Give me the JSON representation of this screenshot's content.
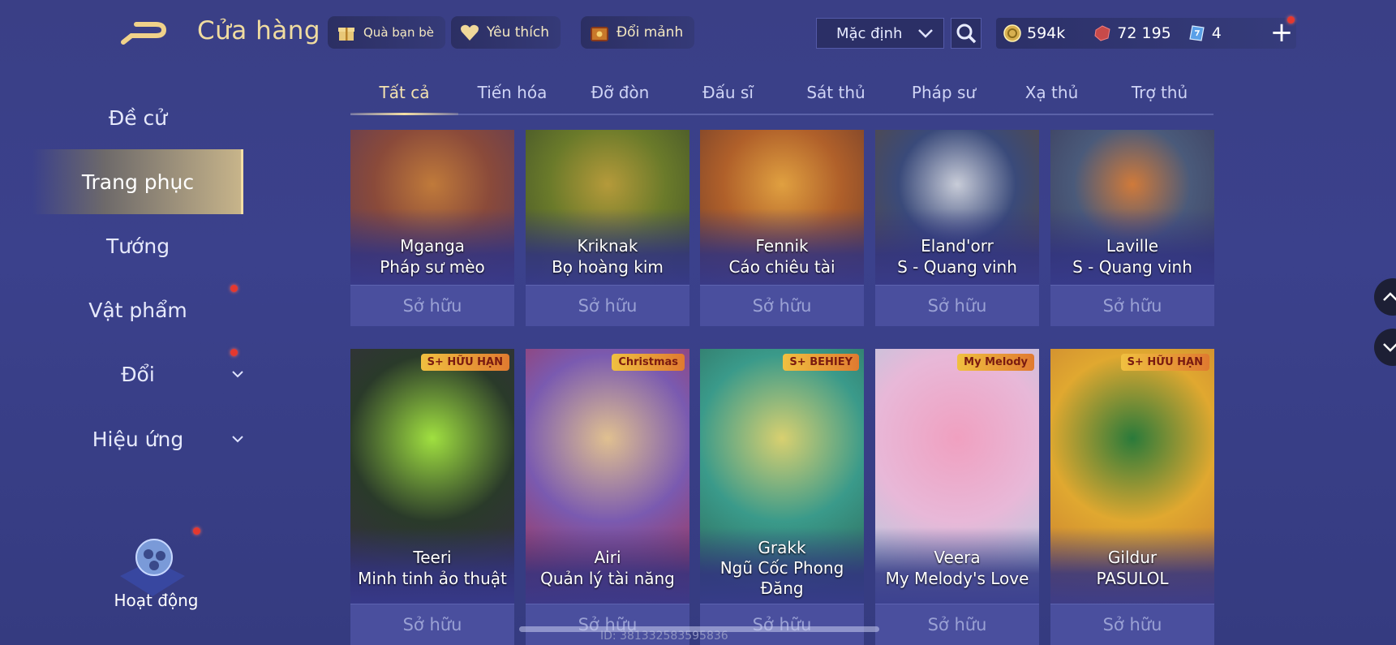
{
  "header": {
    "title": "Cửa hàng",
    "buttons": [
      {
        "label": "Quà bạn bè",
        "icon": "gift-icon"
      },
      {
        "label": "Yêu thích",
        "icon": "heart-icon"
      },
      {
        "label": "Đổi mảnh",
        "icon": "chest-icon"
      }
    ],
    "sort_value": "Mặc định",
    "currencies": [
      {
        "value": "594k",
        "icon": "gold-coin-icon"
      },
      {
        "value": "72 195",
        "icon": "ruby-icon"
      },
      {
        "value": "4",
        "icon": "voucher-icon"
      }
    ]
  },
  "sidebar": {
    "items": [
      {
        "label": "Đề cử"
      },
      {
        "label": "Trang phục",
        "active": true
      },
      {
        "label": "Tướng"
      },
      {
        "label": "Vật phẩm",
        "dot": true
      },
      {
        "label": "Đổi",
        "dot": true,
        "expandable": true
      },
      {
        "label": "Hiệu ứng",
        "expandable": true
      }
    ],
    "activity_label": "Hoạt động"
  },
  "tabs": [
    "Tất cả",
    "Tiến hóa",
    "Đỡ đòn",
    "Đấu sĩ",
    "Sát thủ",
    "Pháp sư",
    "Xạ thủ",
    "Trợ thủ"
  ],
  "active_tab": "Tất cả",
  "cards_row1": [
    {
      "hero": "Mganga",
      "skin": "Pháp sư mèo",
      "status": "Sở hữu",
      "colors": [
        "#8a4a3a",
        "#c07a3a",
        "#5a3a5a"
      ]
    },
    {
      "hero": "Kriknak",
      "skin": "Bọ hoàng kim",
      "status": "Sở hữu",
      "colors": [
        "#6a7a2a",
        "#b59a3a",
        "#3a4a2a"
      ]
    },
    {
      "hero": "Fennik",
      "skin": "Cáo chiêu tài",
      "status": "Sở hữu",
      "colors": [
        "#b0602a",
        "#e0a040",
        "#6a3a2a"
      ]
    },
    {
      "hero": "Eland'orr",
      "skin": "S - Quang vinh",
      "status": "Sở hữu",
      "colors": [
        "#3a4a7a",
        "#c8ccd8",
        "#5a4a3a"
      ]
    },
    {
      "hero": "Laville",
      "skin": "S - Quang vinh",
      "status": "Sở hữu",
      "colors": [
        "#4a5a7a",
        "#d07a3a",
        "#3a3a5a"
      ]
    }
  ],
  "cards_row2": [
    {
      "hero": "Teeri",
      "skin": "Minh tinh ảo thuật",
      "status": "Sở hữu",
      "badge": "S+ HỮU HẠN",
      "colors": [
        "#2a3a2a",
        "#a0e040",
        "#3a2a4a"
      ]
    },
    {
      "hero": "Airi",
      "skin": "Quản lý tài năng",
      "status": "Sở hữu",
      "badge": "Christmas",
      "colors": [
        "#7a5ab0",
        "#e0c090",
        "#b02a3a"
      ]
    },
    {
      "hero": "Grakk",
      "skin": "Ngũ Cốc Phong Đăng",
      "status": "Sở hữu",
      "badge": "S+ BEHIEY",
      "colors": [
        "#3a9a8a",
        "#d8d070",
        "#2a5a4a"
      ]
    },
    {
      "hero": "Veera",
      "skin": "My Melody's Love",
      "status": "Sở hữu",
      "badge": "My Melody",
      "colors": [
        "#e8b8d8",
        "#f0a0c0",
        "#a0d0e0"
      ]
    },
    {
      "hero": "Gildur",
      "skin": "PASULOL",
      "status": "Sở hữu",
      "badge": "S+ HỮU HẠN",
      "colors": [
        "#e0a830",
        "#2a7a3a",
        "#c07030"
      ]
    }
  ],
  "uid_text": "ID: 381332583595836"
}
